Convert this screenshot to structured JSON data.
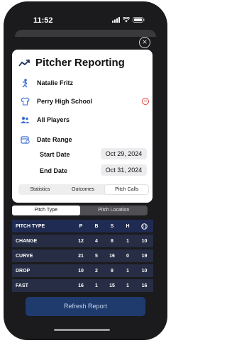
{
  "status_bar": {
    "time": "11:52"
  },
  "header": {
    "title": "Pitcher Reporting",
    "close_icon": "close-icon"
  },
  "filters": {
    "pitcher": "Natalie Fritz",
    "team": "Perry High School",
    "players": "All Players",
    "date_range_label": "Date Range",
    "start_label": "Start Date",
    "start_value": "Oct 29, 2024",
    "end_label": "End Date",
    "end_value": "Oct 31, 2024"
  },
  "report_tabs": {
    "items": [
      "Statistics",
      "Outcomes",
      "Pitch Calls"
    ],
    "selected": "Pitch Calls"
  },
  "view_tabs": {
    "items": [
      "Pitch Type",
      "Pitch Location"
    ],
    "selected": "Pitch Type"
  },
  "table": {
    "columns": [
      "PITCH TYPE",
      "P",
      "B",
      "S",
      "H"
    ],
    "rows": [
      {
        "type": "CHANGE",
        "values": [
          "12",
          "4",
          "8",
          "1",
          "10"
        ]
      },
      {
        "type": "CURVE",
        "values": [
          "21",
          "5",
          "16",
          "0",
          "19"
        ]
      },
      {
        "type": "DROP",
        "values": [
          "10",
          "2",
          "8",
          "1",
          "10"
        ]
      },
      {
        "type": "FAST",
        "values": [
          "16",
          "1",
          "15",
          "1",
          "16"
        ]
      }
    ]
  },
  "actions": {
    "refresh_label": "Refresh Report"
  },
  "colors": {
    "accent": "#1f3b6e",
    "table_header": "#1f2b52",
    "table_row": "#262d44",
    "remove": "#d9403a"
  }
}
